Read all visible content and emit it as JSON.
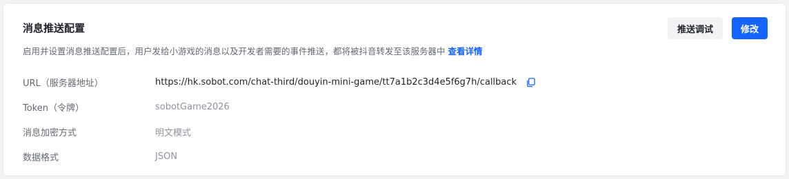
{
  "header": {
    "title": "消息推送配置",
    "description": "启用并设置消息推送配置后，用户发给小游戏的消息以及开发者需要的事件推送，都将被抖音转发至该服务器中",
    "details_link": "查看详情"
  },
  "actions": {
    "debug_label": "推送调试",
    "edit_label": "修改"
  },
  "fields": {
    "url": {
      "label": "URL（服务器地址）",
      "value": "https://hk.sobot.com/chat-third/douyin-mini-game/tt7a1b2c3d4e5f6g7h/callback"
    },
    "token": {
      "label": "Token（令牌）",
      "value": "sobotGame2026"
    },
    "encryption": {
      "label": "消息加密方式",
      "value": "明文模式"
    },
    "format": {
      "label": "数据格式",
      "value": "JSON"
    }
  },
  "icons": {
    "copy": "copy-icon"
  },
  "colors": {
    "accent": "#1664ff",
    "text_primary": "#1f2329",
    "text_secondary": "#646a73",
    "text_muted": "#8f959e"
  }
}
